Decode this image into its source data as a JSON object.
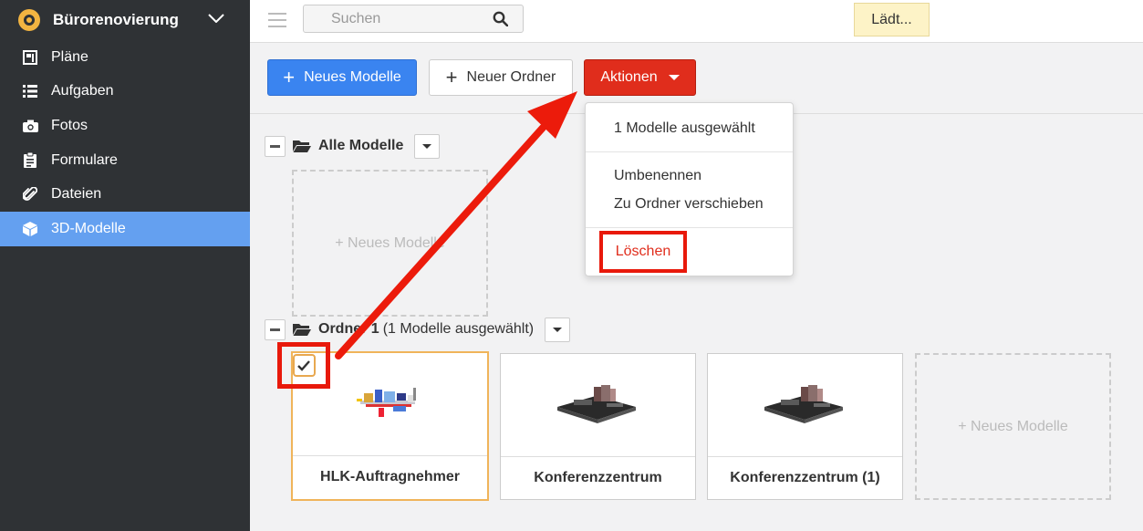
{
  "sidebar": {
    "project_name": "Bürorenovierung",
    "items": [
      {
        "label": "Pläne",
        "icon": "plans-icon"
      },
      {
        "label": "Aufgaben",
        "icon": "list-icon"
      },
      {
        "label": "Fotos",
        "icon": "camera-icon"
      },
      {
        "label": "Formulare",
        "icon": "clipboard-icon"
      },
      {
        "label": "Dateien",
        "icon": "paperclip-icon"
      },
      {
        "label": "3D-Modelle",
        "icon": "cube-icon",
        "active": true
      }
    ]
  },
  "topbar": {
    "search_placeholder": "Suchen",
    "status": "Lädt..."
  },
  "toolbar": {
    "new_model": "Neues Modelle",
    "new_folder": "Neuer Ordner",
    "actions": "Aktionen"
  },
  "actions_menu": {
    "selected_info": "1 Modelle ausgewählt",
    "rename": "Umbenennen",
    "move": "Zu Ordner verschieben",
    "delete": "Löschen"
  },
  "folders": [
    {
      "name": "Alle Modelle",
      "selection": "",
      "empty_card": "+ Neues Modelle"
    },
    {
      "name": "Ordner 1",
      "selection": "(1 Modelle ausgewählt)",
      "cards": [
        {
          "title": "HLK-Auftragnehmer",
          "selected": true
        },
        {
          "title": "Konferenzzentrum",
          "selected": false
        },
        {
          "title": "Konferenzzentrum (1)",
          "selected": false
        }
      ],
      "empty_card": "+ Neues Modelle"
    }
  ],
  "colors": {
    "sidebar_bg": "#2f3235",
    "active_nav": "#64a0f0",
    "primary": "#3a84f0",
    "danger": "#e02d1c",
    "annotation": "#e8190b",
    "selection": "#f0b45a"
  }
}
